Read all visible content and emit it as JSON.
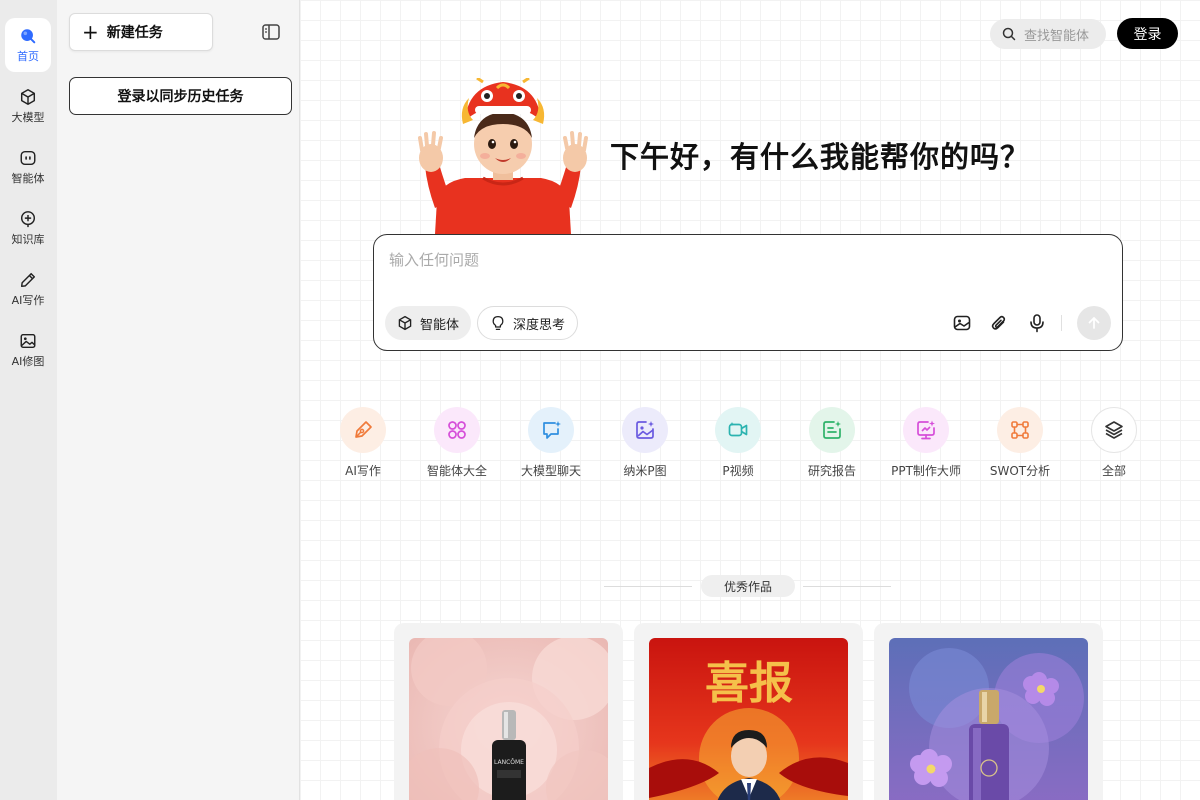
{
  "rail": {
    "items": [
      {
        "label": "首页",
        "icon": "search-icon",
        "active": true
      },
      {
        "label": "大模型",
        "icon": "cube-icon"
      },
      {
        "label": "智能体",
        "icon": "robot-icon"
      },
      {
        "label": "知识库",
        "icon": "knowledge-icon"
      },
      {
        "label": "AI写作",
        "icon": "pencil-icon"
      },
      {
        "label": "AI修图",
        "icon": "image-icon"
      }
    ]
  },
  "panel": {
    "new_task_label": "新建任务",
    "login_sync_label": "登录以同步历史任务"
  },
  "header": {
    "search_placeholder": "查找智能体",
    "login_label": "登录"
  },
  "hero": {
    "greeting": "下午好，有什么我能帮你的吗？"
  },
  "chat": {
    "placeholder": "输入任何问题",
    "agent_pill": "智能体",
    "deep_think_pill": "深度思考"
  },
  "quick_actions": [
    {
      "label": "AI写作",
      "icon": "pen-nib-icon",
      "color": "#f07a3a",
      "bg": "#fdeee4"
    },
    {
      "label": "智能体大全",
      "icon": "grid-circles-icon",
      "color": "#d64fd9",
      "bg": "#fbe8fb"
    },
    {
      "label": "大模型聊天",
      "icon": "chat-bubble-icon",
      "color": "#2f8fe0",
      "bg": "#e4f1fb"
    },
    {
      "label": "纳米P图",
      "icon": "photo-edit-icon",
      "color": "#6a5ae0",
      "bg": "#ecebfb"
    },
    {
      "label": "P视频",
      "icon": "video-icon",
      "color": "#2bb3b0",
      "bg": "#e2f5f4"
    },
    {
      "label": "研究报告",
      "icon": "report-icon",
      "color": "#2fb36a",
      "bg": "#e3f5ea"
    },
    {
      "label": "PPT制作大师",
      "icon": "presentation-icon",
      "color": "#d64fd9",
      "bg": "#fbe8fb"
    },
    {
      "label": "SWOT分析",
      "icon": "nodes-icon",
      "color": "#f07a3a",
      "bg": "#fdeee4"
    },
    {
      "label": "全部",
      "icon": "layers-icon",
      "color": "#333333",
      "bg": "#ffffff"
    }
  ],
  "showcase": {
    "title": "优秀作品",
    "cards": [
      {
        "name": "lancome-serum-flowers",
        "brand_text": "LANCÔME"
      },
      {
        "name": "good-news-poster",
        "headline": "喜报"
      },
      {
        "name": "purple-perfume-flowers"
      }
    ]
  },
  "colors": {
    "accent": "#2f6bff",
    "rail_bg": "#ebebeb",
    "panel_bg": "#f5f5f5"
  }
}
